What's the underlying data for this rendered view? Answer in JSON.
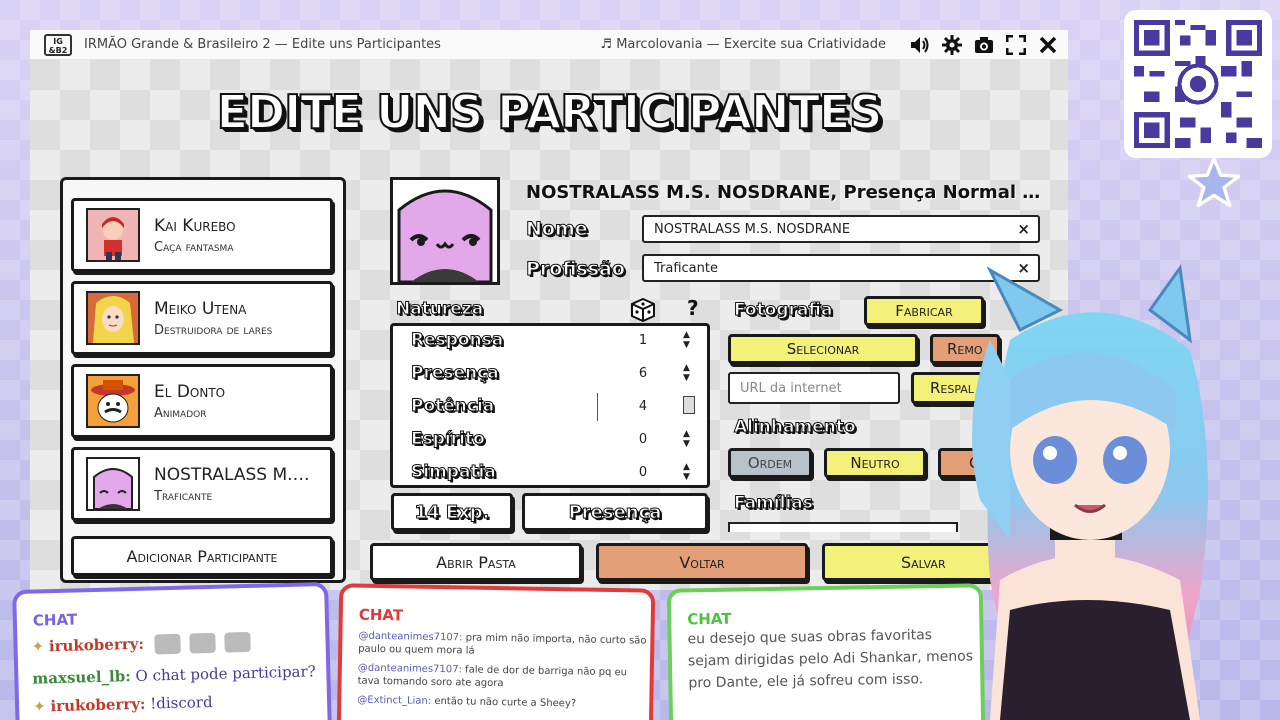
{
  "window": {
    "logo": "IG &B2",
    "title": "IRMÃO Grande & Brasileiro 2 — Edite uns Participantes",
    "music": "♬  Marcolovania — Exercite sua Criatividade"
  },
  "headline": "EDITE UNS PARTICIPANTES",
  "participants": [
    {
      "name": "Kai Kurebo",
      "job": "Caça fantasma"
    },
    {
      "name": "Meiko Utena",
      "job": "Destruidora de lares"
    },
    {
      "name": "El Donto",
      "job": "Animador"
    },
    {
      "name": "NOSTRALASS M.S. NOSDRANE",
      "job": "Traficante"
    }
  ],
  "add_participant": "Adicionar Participante",
  "detail": {
    "title": "NOSTRALASS M.S. NOSDRANE, Presença Normal - T...",
    "nome_label": "Nome",
    "nome_value": "NOSTRALASS M.S. NOSDRANE",
    "profissao_label": "Profissão",
    "profissao_value": "Traficante",
    "clear_icon": "×"
  },
  "natureza": {
    "label": "Natureza",
    "help": "?",
    "stats": [
      {
        "label": "Responsa",
        "value": "1"
      },
      {
        "label": "Presença",
        "value": "6"
      },
      {
        "label": "Potência",
        "value": "4"
      },
      {
        "label": "Espírito",
        "value": "0"
      },
      {
        "label": "Simpatia",
        "value": "0"
      }
    ],
    "exp_button": "14 Exp.",
    "presence_button": "Presença"
  },
  "fotografia": {
    "label": "Fotografia",
    "fabricar": "Fabricar",
    "selecionar": "Selecionar",
    "remover": "Remo",
    "url_placeholder": "URL da internet",
    "respaldar": "Respal"
  },
  "alinhamento": {
    "label": "Alinhamento",
    "ordem": "Ordem",
    "neutro": "Neutro",
    "caos": "C"
  },
  "familias_label": "Famílias",
  "footer": {
    "abrir": "Abrir Pasta",
    "voltar": "Voltar",
    "salvar": "Salvar"
  },
  "chat1": {
    "title": "CHAT",
    "messages": [
      {
        "user": "irukoberry:",
        "text": ""
      },
      {
        "user": "maxsuel_lb:",
        "text": "O chat pode participar?"
      },
      {
        "user": "irukoberry:",
        "text": "!discord"
      }
    ]
  },
  "chat2": {
    "title": "CHAT",
    "messages": [
      {
        "user": "@danteanimes7107:",
        "text": "pra mim não importa, não curto são paulo ou quem mora lá"
      },
      {
        "user": "@danteanimes7107:",
        "text": "fale de dor de barriga não pq eu tava tomando soro ate agora"
      },
      {
        "user": "@Extinct_Lian:",
        "text": "então tu não curte a Sheey?"
      }
    ]
  },
  "chat3": {
    "title": "CHAT",
    "text": "eu desejo que suas obras favoritas sejam dirigidas pelo Adi Shankar, menos pro Dante, ele já sofreu com isso."
  },
  "colors": {
    "yellow": "#f4f17a",
    "orange": "#e3a078",
    "gray_button": "#b8c2c9",
    "chat1": "#8068e6",
    "chat2": "#e13a3a",
    "chat3": "#6ad05a"
  }
}
